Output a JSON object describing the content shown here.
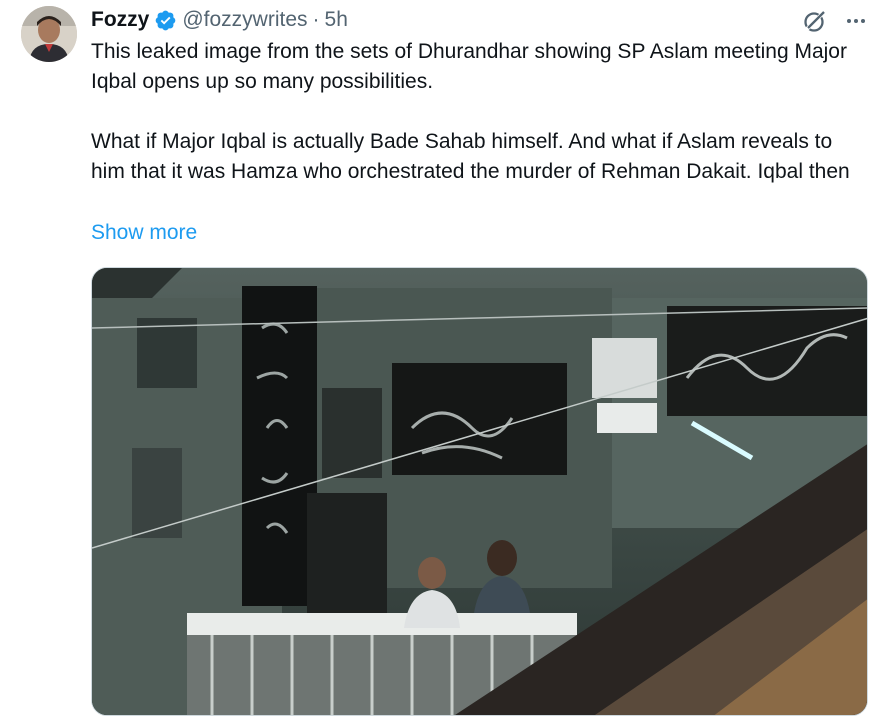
{
  "tweet": {
    "author_name": "Fozzy",
    "handle": "@fozzywrites",
    "separator": "·",
    "time": "5h",
    "text_lines_1": "This leaked image from the sets of Dhurandhar showing SP Aslam meeting Major Iqbal opens up so many possibilities.",
    "text_lines_2": "What if Major Iqbal is actually Bade Sahab himself. And what if Aslam reveals to him that it was Hamza who orchestrated the murder of Rehman Dakait. Iqbal then",
    "show_more": "Show more"
  },
  "icons": {
    "verified": "verified-badge-icon",
    "grok": "grok-icon",
    "more": "more-options-icon"
  },
  "colors": {
    "accent": "#1d9bf0",
    "text": "#0f1419",
    "secondary": "#536471"
  }
}
